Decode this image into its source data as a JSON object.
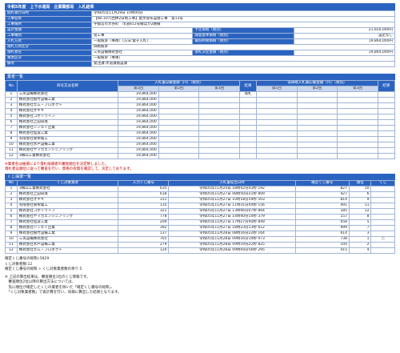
{
  "title": "令和5年度　上下水道局　企業職部局　入札結果",
  "info": {
    "rows": [
      {
        "label": "開札執行日時",
        "value": "令和05年11月29日 10時00分"
      },
      {
        "label": "工事名称",
        "value": "【No.107]西休2日制工事】配水管布設替工事　第13号"
      },
      {
        "label": "工事場所",
        "value": "宇都宮市大谷町　市道812号線ほか2路線"
      }
    ],
    "row4": {
      "label": "設計金額",
      "right_label": "予定価格（税別）",
      "right_value": "21,920,000円"
    },
    "row5": {
      "label": "工事種別",
      "value": "管工事",
      "right_label": "調査基準価格（税別）",
      "right_value": "設定なし"
    },
    "row6": {
      "label": "入札方式",
      "value": "一般競争（事後）(方法:電子入札)",
      "right_label": "最低制限価格（税別）",
      "right_value": "19,864,000円"
    },
    "row7": {
      "label": "落札方式区分",
      "value": "価格競争"
    },
    "row8": {
      "label": "落札者名",
      "value": "三英設備株式会社",
      "right_label": "落札決定金額（税別）",
      "right_value": "19,864,000円"
    },
    "row9": {
      "label": "業者区分",
      "value": "一般競争（事後）"
    },
    "row10": {
      "label": "備考",
      "value": "発注課:水道課施設課"
    }
  },
  "section1": {
    "header": "業者一覧",
    "col_no": "No",
    "col_name": "商号又は名称",
    "col_bid": "入札書記載金額（円）（税別）",
    "col_result": "結果",
    "col_low": "低価格入札書記載金額（円）（税別）",
    "col_result2": "結果",
    "sub": [
      "第1回",
      "第2回",
      "第3回",
      "第1回",
      "第2回",
      "第3回"
    ],
    "rows": [
      {
        "no": "1",
        "name": "三英設備株式会社",
        "bid": "19,864,000",
        "result": "落札"
      },
      {
        "no": "2",
        "name": "株式会社植竹設備工業",
        "bid": "19,864,000",
        "result": ""
      },
      {
        "no": "3",
        "name": "株式会社エム・プロダクト",
        "bid": "19,864,000",
        "result": ""
      },
      {
        "no": "4",
        "name": "株式会社オギギ",
        "bid": "19,864,000",
        "result": ""
      },
      {
        "no": "5",
        "name": "株式会社コボリライフ",
        "bid": "19,864,000",
        "result": ""
      },
      {
        "no": "6",
        "name": "株式会社上田環境",
        "bid": "19,864,000",
        "result": ""
      },
      {
        "no": "7",
        "name": "株式会社シンエイ企業",
        "bid": "19,864,000",
        "result": ""
      },
      {
        "no": "8",
        "name": "株式会社仙波工業",
        "bid": "19,864,000",
        "result": ""
      },
      {
        "no": "9",
        "name": "有限会社東栄電工",
        "bid": "19,864,000",
        "result": ""
      },
      {
        "no": "10",
        "name": "株式会社水戸設備工業",
        "bid": "19,864,000",
        "result": ""
      },
      {
        "no": "11",
        "name": "株式会社ヤマカエンジニアリング",
        "bid": "19,864,000",
        "result": ""
      },
      {
        "no": "12",
        "name": "3横山工業株式会社",
        "bid": "19,864,000",
        "result": ""
      }
    ]
  },
  "notes": [
    "※業者名は抽選により落札候補者の審査順位を決定致しました。",
    "落札者は順位に従って審査を行い、資格の有無を確認して、決定しております。"
  ],
  "section2": {
    "header": "くじ抽選一覧",
    "cols": [
      "No",
      "くじ対象業者",
      "入力くじ番号",
      "入札書提出日時",
      "確定くじ番号",
      "順位",
      "くじ"
    ],
    "rows": [
      {
        "no": "1",
        "name": "3横山工業株式会社",
        "num": "635",
        "time": "令和05年11月24日 18時42分43秒 192",
        "final": "827",
        "rank": "10",
        "mark": ""
      },
      {
        "no": "2",
        "name": "株式会社上田環境",
        "num": "618",
        "time": "令和05年11月27日 08時50分21秒 809",
        "final": "427",
        "rank": "6",
        "mark": ""
      },
      {
        "no": "3",
        "name": "株式会社オギギ",
        "num": "311",
        "time": "令和05年11月27日 10時18分59秒 503",
        "final": "814",
        "rank": "9",
        "mark": ""
      },
      {
        "no": "4",
        "name": "有限会社東栄電工",
        "num": "135",
        "time": "令和05年11月27日 11時31分44秒 156",
        "final": "491",
        "rank": "11",
        "mark": ""
      },
      {
        "no": "5",
        "name": "株式会社コボリライフ",
        "num": "321",
        "time": "令和05年11月27日 13時06分07秒 864",
        "final": "185",
        "rank": "12",
        "mark": ""
      },
      {
        "no": "6",
        "name": "株式会社ヤマカエンジニアリング",
        "num": "778",
        "time": "令和05年11月27日 14時40分14秒 379",
        "final": "157",
        "rank": "8",
        "mark": ""
      },
      {
        "no": "7",
        "name": "株式会社仙波工業",
        "num": "209",
        "time": "令和05年11月27日 17時27分40秒 849",
        "final": "058",
        "rank": "5",
        "mark": ""
      },
      {
        "no": "8",
        "name": "株式会社シンエイ企業",
        "num": "392",
        "time": "令和05年11月27日 18時33分13秒 612",
        "final": "999",
        "rank": "7",
        "mark": ""
      },
      {
        "no": "9",
        "name": "株式会社植竹設備工業",
        "num": "137",
        "time": "令和05年11月28日 08時16分22秒 164",
        "final": "614",
        "rank": "3",
        "mark": ""
      },
      {
        "no": "10",
        "name": "三英設備株式会社",
        "num": "765",
        "time": "令和05年11月28日 09時16分19秒 973",
        "final": "738",
        "rank": "1",
        "mark": "○"
      },
      {
        "no": "11",
        "name": "株式会社水戸設備工業",
        "num": "279",
        "time": "令和05年11月28日 09時19分22秒 825",
        "final": "104",
        "rank": "2",
        "mark": ""
      },
      {
        "no": "12",
        "name": "株式会社エム・プロダクト",
        "num": "120",
        "time": "令和05年11月28日 09時44分56秒 295",
        "final": "415",
        "rank": "4",
        "mark": ""
      }
    ]
  },
  "footer": [
    "確定くじ番号の総和):5829",
    "くじ対象者数:12",
    "確定くじ番号の総和 ÷ くじ対象業者数の余り:5"
  ],
  "footer2": [
    "※ 上記の算出結果は、審査順位1位のくじ情報です。",
    "　審査順位2位以降の算出方法については、",
    "　先に順位が確定したくじの業者を除いた「確定くじ番号の総和」、",
    "　「くじ対象業者数」で再計算を行い、同様に算出した結果となります。"
  ]
}
